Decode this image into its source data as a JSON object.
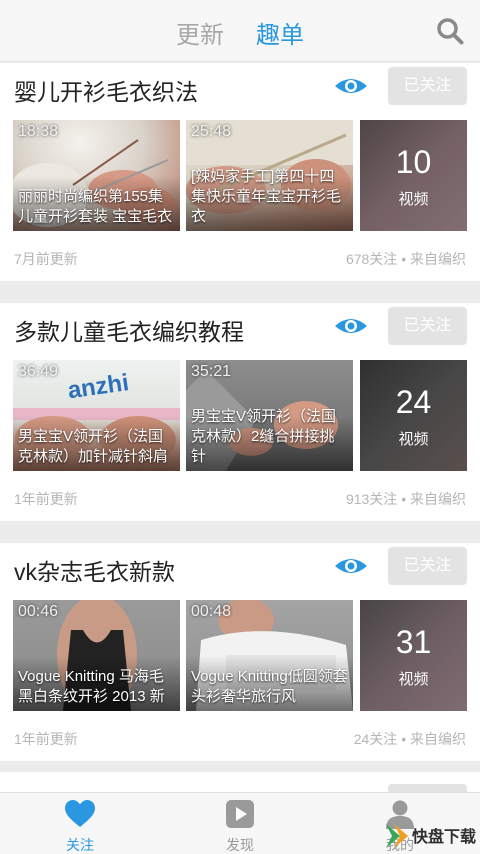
{
  "header": {
    "tabs": [
      {
        "label": "更新",
        "active": false
      },
      {
        "label": "趣单",
        "active": true
      }
    ],
    "search_icon": "search-icon"
  },
  "cards": [
    {
      "title": "婴儿开衫毛衣织法",
      "follow_label": "已关注",
      "videos": [
        {
          "duration": "18:38",
          "title": "丽丽时尚编织第155集儿童开衫套装 宝宝毛衣"
        },
        {
          "duration": "25:48",
          "title": "[辣妈家手工]第四十四集快乐童年宝宝开衫毛衣"
        }
      ],
      "more": {
        "count": "10",
        "unit": "视频"
      },
      "updated": "7月前更新",
      "stats": "678关注 • 来自编织"
    },
    {
      "title": "多款儿童毛衣编织教程",
      "follow_label": "已关注",
      "videos": [
        {
          "duration": "36:49",
          "title": "男宝宝V领开衫（法国克林款）加针减针斜肩"
        },
        {
          "duration": "35:21",
          "title": "男宝宝V领开衫（法国克林款）2缝合拼接挑针"
        }
      ],
      "more": {
        "count": "24",
        "unit": "视频"
      },
      "updated": "1年前更新",
      "stats": "913关注 • 来自编织"
    },
    {
      "title": "vk杂志毛衣新款",
      "follow_label": "已关注",
      "videos": [
        {
          "duration": "00:46",
          "title": "Vogue Knitting 马海毛黑白条纹开衫 2013 新"
        },
        {
          "duration": "00:48",
          "title": "Vogue Knitting低圆领套头衫奢华旅行风"
        }
      ],
      "more": {
        "count": "31",
        "unit": "视频"
      },
      "updated": "1年前更新",
      "stats": "24关注 • 来自编织"
    }
  ],
  "bottom_nav": [
    {
      "label": "关注",
      "icon": "heart-icon",
      "active": true
    },
    {
      "label": "发现",
      "icon": "play-icon",
      "active": false
    },
    {
      "label": "我的",
      "icon": "person-icon",
      "active": false
    }
  ],
  "watermark": {
    "text": "快盘下载"
  },
  "colors": {
    "accent": "#2a97e0",
    "inactive": "#a8a8a8",
    "button_bg": "#e3e3e3"
  }
}
